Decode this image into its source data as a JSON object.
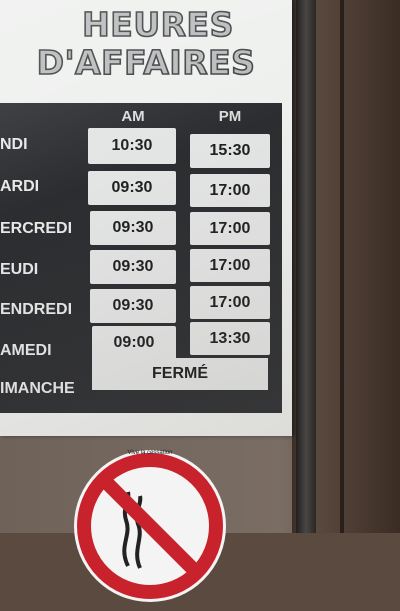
{
  "sign": {
    "title_line1": "HEURES",
    "title_line2": "D'AFFAIRES",
    "am_label": "AM",
    "pm_label": "PM",
    "rows": [
      {
        "day": "LUNDI",
        "visible_day": "NDI",
        "am": "10:30",
        "pm": "15:30"
      },
      {
        "day": "MARDI",
        "visible_day": "ARDI",
        "am": "09:30",
        "pm": "17:00"
      },
      {
        "day": "MERCREDI",
        "visible_day": "ERCREDI",
        "am": "09:30",
        "pm": "17:00"
      },
      {
        "day": "JEUDI",
        "visible_day": "EUDI",
        "am": "09:30",
        "pm": "17:00"
      },
      {
        "day": "VENDREDI",
        "visible_day": "ENDREDI",
        "am": "09:30",
        "pm": "17:00"
      },
      {
        "day": "SAMEDI",
        "visible_day": "AMEDI",
        "am": "09:00",
        "pm": "13:30"
      }
    ],
    "sunday_label": "IMANCHE",
    "closed_label": "FERMÉ"
  },
  "sticker": {
    "icon": "no-smoking-icon",
    "caption": "Vive la cessation",
    "ring_color": "#c8232c"
  }
}
